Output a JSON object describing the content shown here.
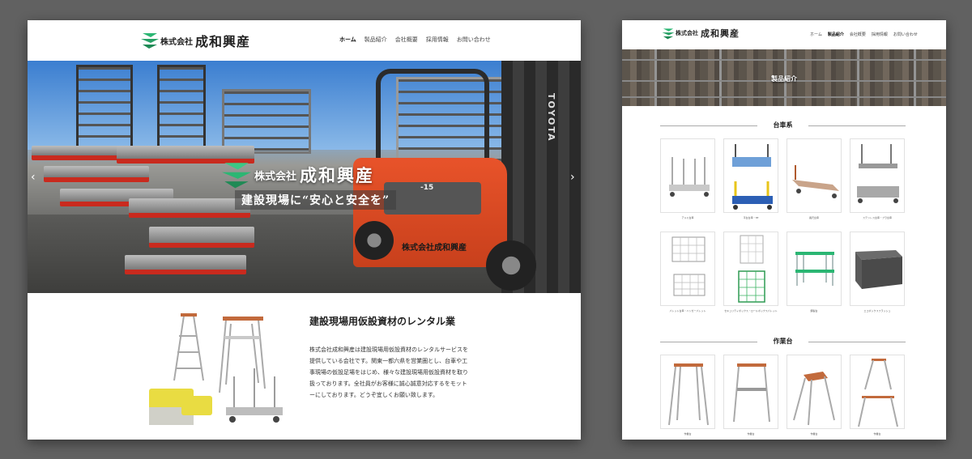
{
  "left_page": {
    "logo": {
      "company_prefix": "株式会社",
      "company_name": "成和興産",
      "icon": "logo-icon"
    },
    "nav": [
      "ホーム",
      "製品紹介",
      "会社概要",
      "採用情報",
      "お問い合わせ"
    ],
    "nav_active_index": 0,
    "hero": {
      "logo_prefix": "株式会社",
      "logo_name": "成和興産",
      "tagline": "建設現場に“安心と安全を”",
      "forklift_brand": "TOYOTA",
      "forklift_model": "-15",
      "forklift_label": "株式会社成和興産",
      "prev_icon": "chevron-left-icon",
      "next_icon": "chevron-right-icon"
    },
    "intro": {
      "title": "建設現場用仮設資材のレンタル業",
      "body": "株式会社成和興産は建設現場用仮設資材のレンタルサービスを提供している会社です。関東一都六県を営業圏とし、台車や工事現場の仮設足場をはじめ、様々な建設現場用仮設資材を取り扱っております。全社員がお客様に誠心誠意対応するをモットーにしております。どうぞ宜しくお願い致します。"
    }
  },
  "right_page": {
    "logo": {
      "company_prefix": "株式会社",
      "company_name": "成和興産"
    },
    "nav": [
      "ホーム",
      "製品紹介",
      "会社概要",
      "採用情報",
      "お問い合わせ"
    ],
    "nav_active_index": 1,
    "banner_title": "製品紹介",
    "sections": [
      {
        "title": "台車系",
        "items": [
          "アルミ台車",
          "平台台車・3E",
          "長尺台車",
          "ステンレス台車・プラ台車",
          "パレット台車・ハンガーパレット",
          "セキュリティボックス・ロールボックスパレット",
          "鋼製台",
          "エコボックスフラッシュ"
        ]
      },
      {
        "title": "作業台",
        "items": [
          "作業台",
          "作業台",
          "作業台",
          "作業台"
        ]
      }
    ]
  },
  "colors": {
    "background": "#616161",
    "logo_green": "#2bb673",
    "forklift_orange": "#e8532a",
    "cart_red": "#c92a1e"
  }
}
